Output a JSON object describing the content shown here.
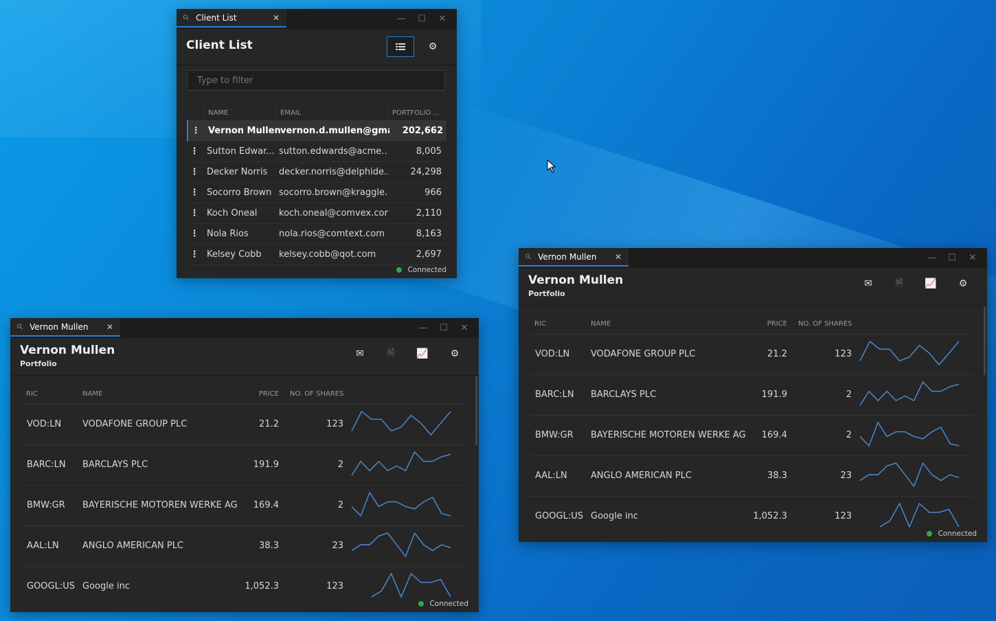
{
  "client_list": {
    "tab_title": "Client List",
    "title": "Client List",
    "filter_placeholder": "Type to filter",
    "columns": [
      "NAME",
      "EMAIL",
      "PORTFOLIO ..."
    ],
    "rows": [
      {
        "name": "Vernon Mullen",
        "email": "vernon.d.mullen@gmail...",
        "portfolio": "202,662"
      },
      {
        "name": "Sutton Edwar...",
        "email": "sutton.edwards@acme....",
        "portfolio": "8,005"
      },
      {
        "name": "Decker Norris",
        "email": "decker.norris@delphide...",
        "portfolio": "24,298"
      },
      {
        "name": "Socorro Brown",
        "email": "socorro.brown@kraggle...",
        "portfolio": "966"
      },
      {
        "name": "Koch Oneal",
        "email": "koch.oneal@comvex.com",
        "portfolio": "2,110"
      },
      {
        "name": "Nola Rios",
        "email": "nola.rios@comtext.com",
        "portfolio": "8,163"
      },
      {
        "name": "Kelsey Cobb",
        "email": "kelsey.cobb@qot.com",
        "portfolio": "2,697"
      }
    ],
    "status": "Connected"
  },
  "portfolio": {
    "tab_title": "Vernon Mullen",
    "title": "Vernon Mullen",
    "subtitle": "Portfolio",
    "columns": [
      "RIC",
      "NAME",
      "PRICE",
      "NO. OF SHARES"
    ],
    "rows": [
      {
        "ric": "VOD:LN",
        "name": "VODAFONE GROUP PLC",
        "price": "21.2",
        "shares": "123",
        "spark": [
          2,
          7,
          5,
          5,
          2,
          3,
          6,
          4,
          1,
          4,
          7
        ]
      },
      {
        "ric": "BARC:LN",
        "name": "BARCLAYS PLC",
        "price": "191.9",
        "shares": "2",
        "spark": [
          1,
          4,
          2,
          4,
          2,
          3,
          2,
          6,
          4,
          4,
          5,
          5.5
        ]
      },
      {
        "ric": "BMW:GR",
        "name": "BAYERISCHE MOTOREN WERKE AG",
        "price": "169.4",
        "shares": "2",
        "spark": [
          3,
          1,
          6,
          3,
          4,
          4,
          3,
          2.5,
          4,
          5,
          1.5,
          1
        ]
      },
      {
        "ric": "AAL:LN",
        "name": "ANGLO AMERICAN PLC",
        "price": "38.3",
        "shares": "23",
        "spark": [
          2,
          3,
          3,
          4.5,
          5,
          3,
          1,
          5,
          3,
          2,
          3,
          2.5
        ]
      },
      {
        "ric": "GOOGL:US",
        "name": "Google inc",
        "price": "1,052.3",
        "shares": "123",
        "spark": [
          null,
          null,
          1,
          2,
          5,
          1,
          5,
          3.5,
          3.5,
          4,
          1
        ]
      }
    ],
    "status": "Connected"
  },
  "colors": {
    "accent": "#2a7fd4",
    "connected": "#2ea84a",
    "spark": "#4a8fd8"
  },
  "icons": [
    "link-icon",
    "close-icon",
    "minimize-icon",
    "maximize-icon",
    "list-icon",
    "gear-icon",
    "mail-icon",
    "export-icon",
    "chart-icon",
    "cursor-icon"
  ]
}
